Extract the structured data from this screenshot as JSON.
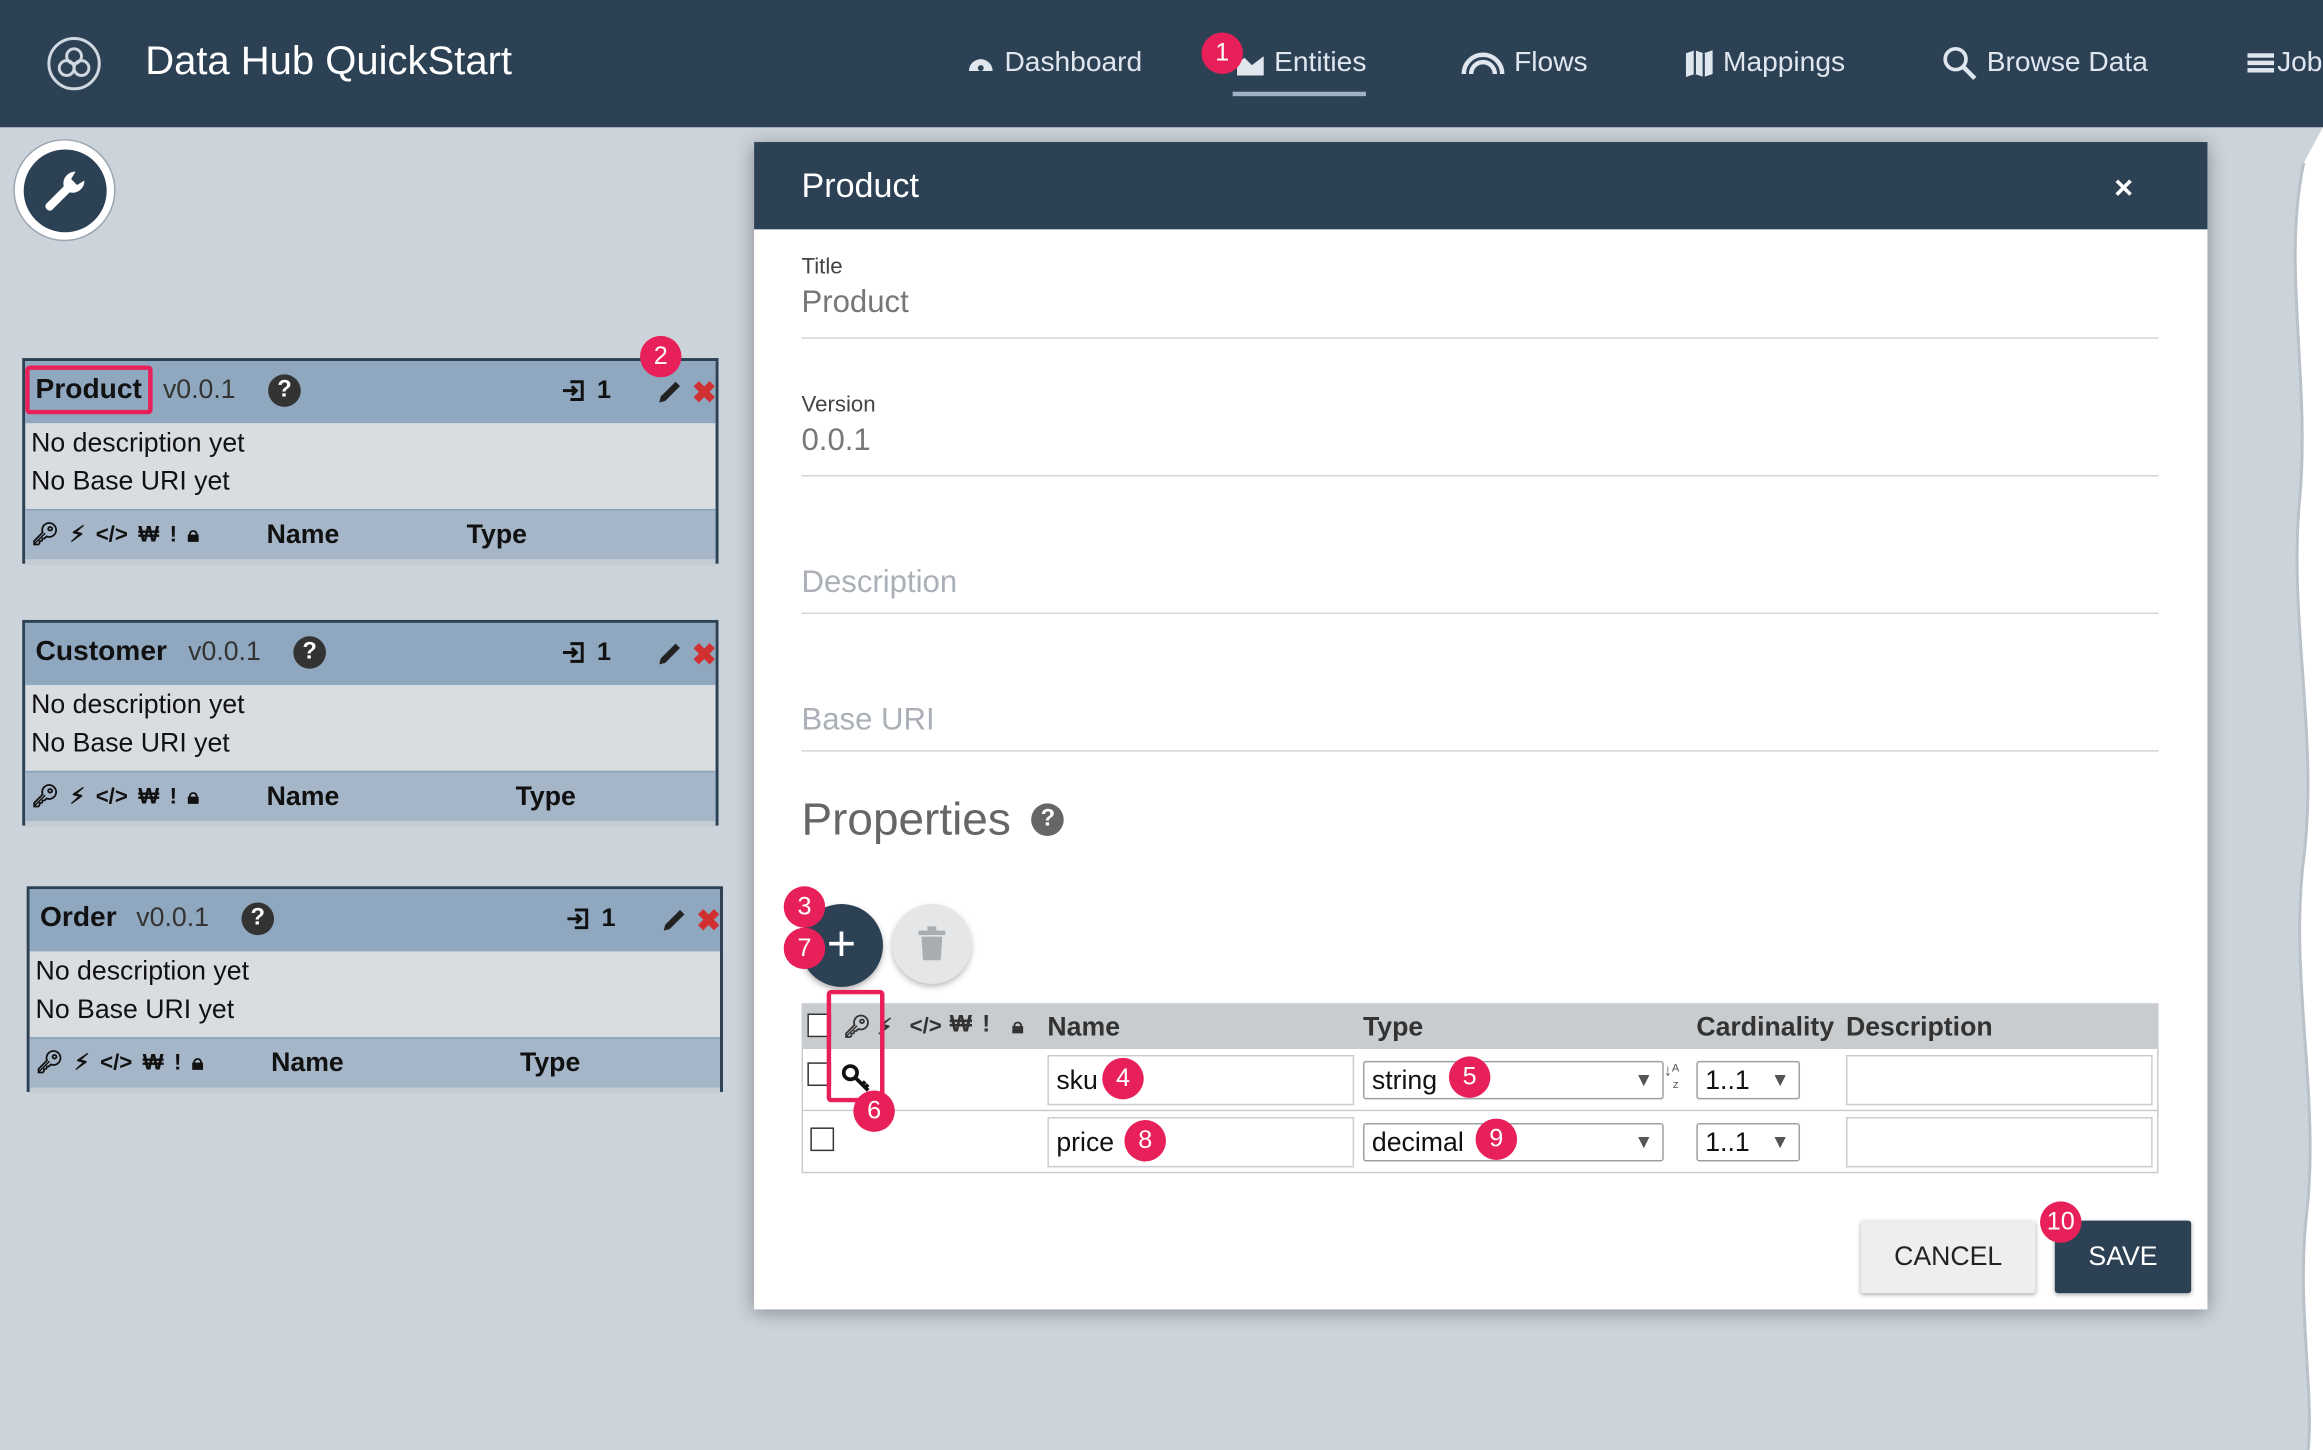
{
  "app": {
    "title": "Data Hub QuickStart",
    "nav": {
      "dashboard": "Dashboard",
      "entities": "Entities",
      "flows": "Flows",
      "mappings": "Mappings",
      "browse": "Browse Data",
      "jobs": "Job"
    }
  },
  "annotations": [
    "1",
    "2",
    "3",
    "4",
    "5",
    "6",
    "7",
    "8",
    "9",
    "10"
  ],
  "cards": [
    {
      "name": "Product",
      "version": "v0.0.1",
      "count": "1",
      "description": "No description yet",
      "base_uri": "No Base URI yet",
      "col_name": "Name",
      "col_type": "Type"
    },
    {
      "name": "Customer",
      "version": "v0.0.1",
      "count": "1",
      "description": "No description yet",
      "base_uri": "No Base URI yet",
      "col_name": "Name",
      "col_type": "Type"
    },
    {
      "name": "Order",
      "version": "v0.0.1",
      "count": "1",
      "description": "No description yet",
      "base_uri": "No Base URI yet",
      "col_name": "Name",
      "col_type": "Type"
    }
  ],
  "modal": {
    "title": "Product",
    "close": "×",
    "title_label": "Title",
    "title_value": "Product",
    "version_label": "Version",
    "version_value": "0.0.1",
    "description_placeholder": "Description",
    "base_uri_placeholder": "Base URI",
    "properties_heading": "Properties",
    "add_symbol": "+",
    "table_headers": {
      "name": "Name",
      "type": "Type",
      "cardinality": "Cardinality",
      "description": "Description"
    },
    "rows": [
      {
        "name": "sku",
        "type": "string",
        "cardinality": "1..1",
        "description": ""
      },
      {
        "name": "price",
        "type": "decimal",
        "cardinality": "1..1",
        "description": ""
      }
    ],
    "cancel": "CANCEL",
    "save": "SAVE"
  },
  "colors": {
    "navbar": "#2d4155",
    "badge": "#e8205a",
    "backdrop": "#ccd3da",
    "card_header": "#8fa7bf"
  }
}
